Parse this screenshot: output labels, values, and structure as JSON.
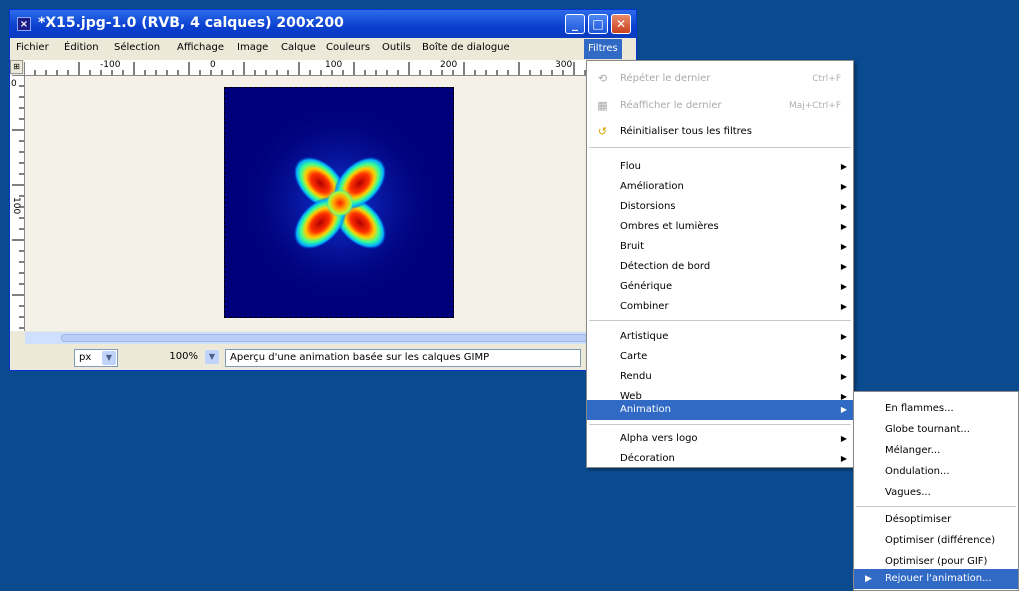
{
  "window": {
    "icon_glyph": "×",
    "title": "*X15.jpg-1.0 (RVB, 4 calques) 200x200",
    "min_glyph": "_",
    "max_glyph": "□",
    "close_glyph": "✕"
  },
  "menubar": {
    "items": [
      "Fichier",
      "Édition",
      "Sélection",
      "Affichage",
      "Image",
      "Calque",
      "Couleurs",
      "Outils",
      "Boîte de dialogue",
      "Filtres"
    ],
    "active": "Filtres"
  },
  "rulers": {
    "top": [
      "-100",
      "0",
      "100",
      "200",
      "300"
    ],
    "left": [
      "0",
      "100"
    ],
    "corner_glyph": "⊞"
  },
  "status": {
    "unit": "px",
    "zoom": "100%",
    "message": "Aperçu d'une animation basée sur les calques GIMP",
    "dropdown_glyph": "▼"
  },
  "filters_menu": {
    "top": [
      {
        "label": "Répéter le dernier",
        "shortcut": "Ctrl+F",
        "disabled": true,
        "icon": "repeat-icon",
        "glyph": "⟲"
      },
      {
        "label": "Réafficher le dernier",
        "shortcut": "Maj+Ctrl+F",
        "disabled": true,
        "icon": "reshow-icon",
        "glyph": "▦"
      },
      {
        "label": "Réinitialiser tous les filtres",
        "shortcut": "",
        "disabled": false,
        "icon": "reset-icon",
        "glyph": "↺"
      }
    ],
    "group1": [
      "Flou",
      "Amélioration",
      "Distorsions",
      "Ombres et lumières",
      "Bruit",
      "Détection de bord",
      "Générique",
      "Combiner"
    ],
    "group2": [
      "Artistique",
      "Carte",
      "Rendu",
      "Web",
      "Animation"
    ],
    "group3": [
      "Alpha vers logo",
      "Décoration"
    ],
    "highlighted": "Animation",
    "submenu_glyph": "▶"
  },
  "animation_submenu": {
    "group1": [
      "En flammes...",
      "Globe tournant...",
      "Mélanger...",
      "Ondulation...",
      "Vagues..."
    ],
    "group2": [
      "Désoptimiser",
      "Optimiser (différence)",
      "Optimiser (pour GIF)",
      "Rejouer l'animation..."
    ],
    "highlighted": "Rejouer l'animation...",
    "pointer_glyph": "▶"
  },
  "colors": {
    "desktop": "#0a4a8f",
    "highlight": "#316ac5",
    "image_background": "#00007a"
  }
}
